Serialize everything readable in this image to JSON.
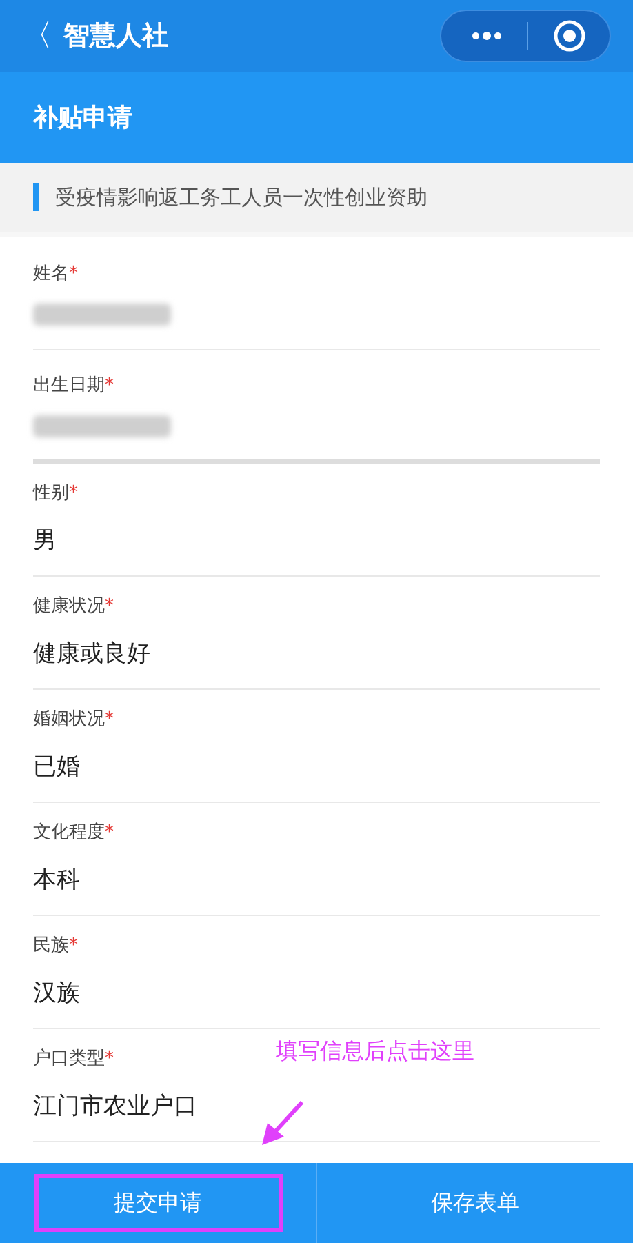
{
  "nav_bar": {
    "back": "〈",
    "title": "智慧人社"
  },
  "header": {
    "title": "补贴申请"
  },
  "section": {
    "title": "受疫情影响返工务工人员一次性创业资助"
  },
  "fields": [
    {
      "label": "姓名",
      "required_mark": "*",
      "kind": "redacted"
    },
    {
      "label": "出生日期",
      "required_mark": "*",
      "kind": "redacted"
    },
    {
      "label": "性别",
      "required_mark": "*",
      "kind": "text",
      "value": "男"
    },
    {
      "label": "健康状况",
      "required_mark": "*",
      "kind": "text",
      "value": "健康或良好"
    },
    {
      "label": "婚姻状况",
      "required_mark": "*",
      "kind": "text",
      "value": "已婚"
    },
    {
      "label": "文化程度",
      "required_mark": "*",
      "kind": "text",
      "value": "本科"
    },
    {
      "label": "民族",
      "required_mark": "*",
      "kind": "text",
      "value": "汉族"
    },
    {
      "label": "户口类型",
      "required_mark": "*",
      "kind": "text",
      "value": "江门市农业户口"
    }
  ],
  "annotation": {
    "text": "填写信息后点击这里"
  },
  "buttons": [
    {
      "label": "提交申请",
      "highlighted": true
    },
    {
      "label": "保存表单",
      "highlighted": false
    }
  ]
}
